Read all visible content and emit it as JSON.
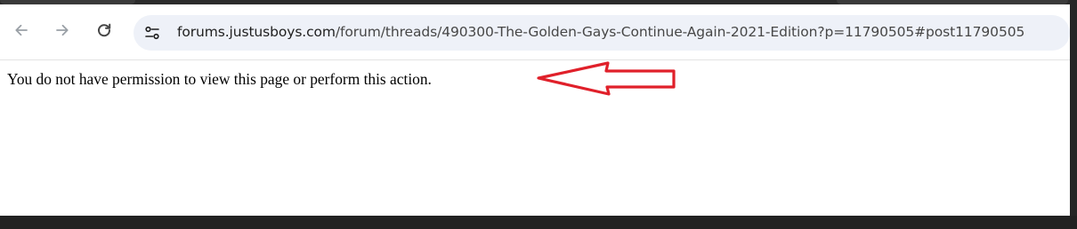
{
  "browser": {
    "navigation": {
      "back_icon": "arrow-left-icon",
      "forward_icon": "arrow-right-icon",
      "reload_icon": "reload-icon"
    },
    "address_bar": {
      "site_info_icon": "tune-icon",
      "url_host": "forums.justusboys.com",
      "url_path": "/forum/threads/490300-The-Golden-Gays-Continue-Again-2021-Edition?p=11790505#post11790505"
    }
  },
  "page": {
    "message": "You do not have permission to view this page or perform this action."
  },
  "annotation": {
    "type": "arrow",
    "color": "#e0202a",
    "direction": "left"
  },
  "colors": {
    "toolbar_bg": "#ffffff",
    "omnibox_bg": "#eef1f8",
    "frame_dark": "#202020"
  }
}
